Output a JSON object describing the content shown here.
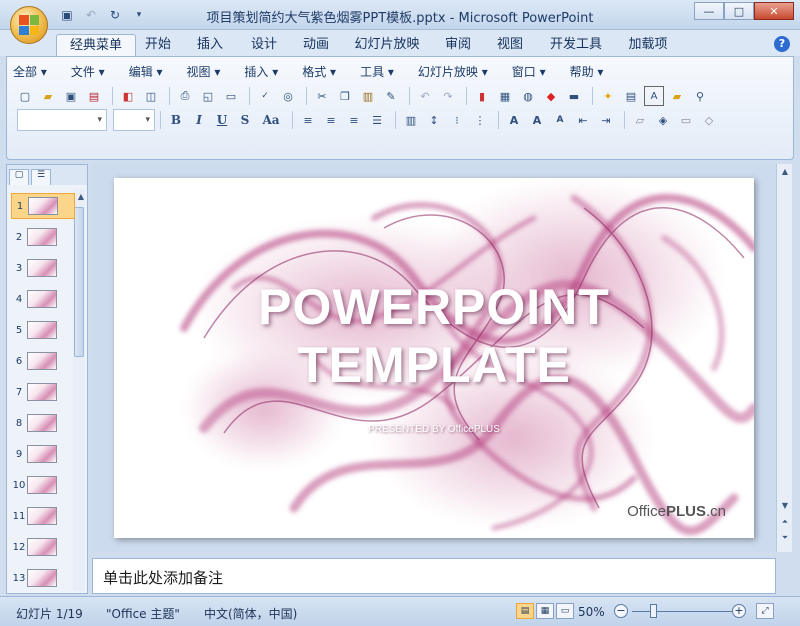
{
  "window": {
    "title": "项目策划简约大气紫色烟雾PPT模板.pptx - Microsoft PowerPoint",
    "minimize": "—",
    "maximize": "□",
    "close": "✕"
  },
  "ribbon_tabs": [
    "经典菜单",
    "开始",
    "插入",
    "设计",
    "动画",
    "幻灯片放映",
    "审阅",
    "视图",
    "开发工具",
    "加载项"
  ],
  "active_tab": "经典菜单",
  "help": "?",
  "menu": [
    "全部 ▾",
    "文件 ▾",
    "编辑 ▾",
    "视图 ▾",
    "插入 ▾",
    "格式 ▾",
    "工具 ▾",
    "幻灯片放映 ▾",
    "窗口 ▾",
    "帮助 ▾"
  ],
  "format": {
    "bold": "B",
    "italic": "I",
    "underline": "U",
    "shadow": "S",
    "case": "Aa"
  },
  "slides_panel": {
    "items": [
      {
        "num": "1"
      },
      {
        "num": "2"
      },
      {
        "num": "3"
      },
      {
        "num": "4"
      },
      {
        "num": "5"
      },
      {
        "num": "6"
      },
      {
        "num": "7"
      },
      {
        "num": "8"
      },
      {
        "num": "9"
      },
      {
        "num": "10"
      },
      {
        "num": "11"
      },
      {
        "num": "12"
      },
      {
        "num": "13"
      }
    ],
    "selected": "1"
  },
  "slide": {
    "title_line1": "POWERPOINT",
    "title_line2": "TEMPLATE",
    "subtitle": "PRESENTED BY OfficePLUS",
    "brand_prefix": "Office",
    "brand_bold": "PLUS",
    "brand_suffix": ".cn",
    "accent_color": "#b03878"
  },
  "notes": {
    "placeholder": "单击此处添加备注"
  },
  "statusbar": {
    "slide_counter": "幻灯片 1/19",
    "theme": "\"Office 主题\"",
    "language": "中文(简体，中国)",
    "zoom": "50%"
  }
}
